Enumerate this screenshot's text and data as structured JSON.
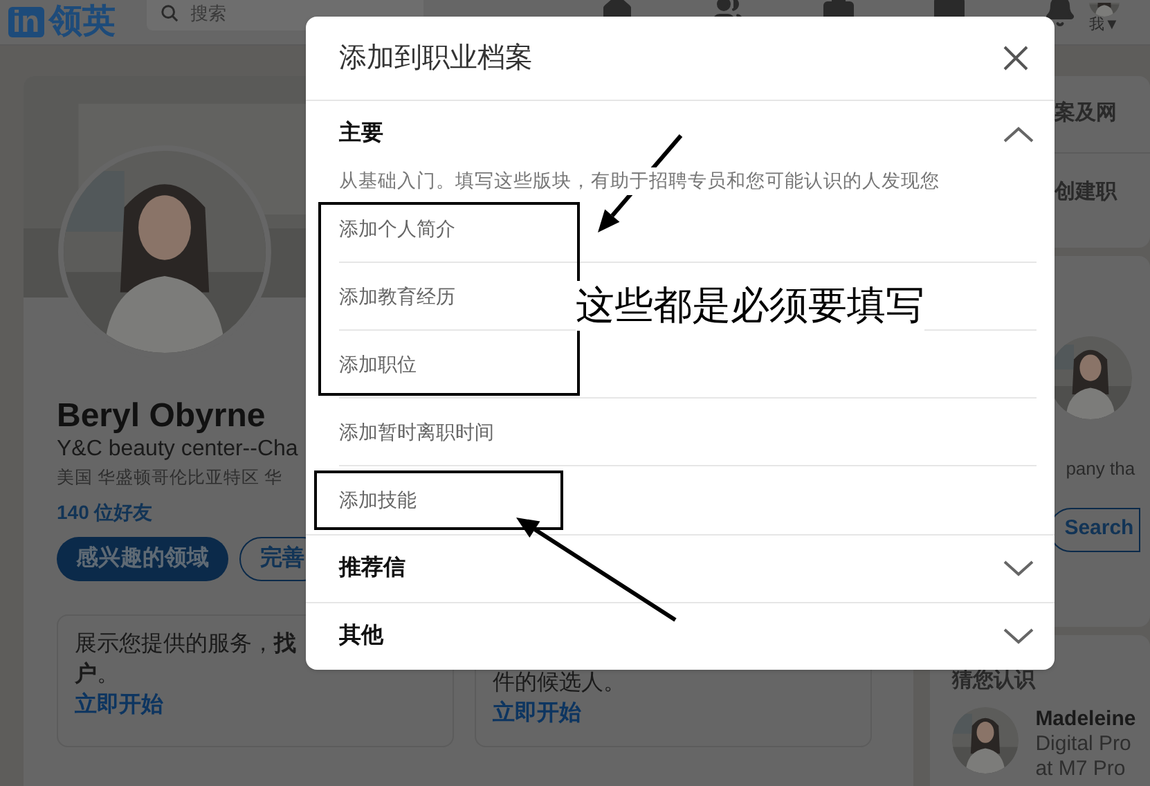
{
  "nav": {
    "logo_badge": "in",
    "logo_text": "领英",
    "search": {
      "placeholder": "搜索"
    },
    "me_label": "我▼"
  },
  "profile": {
    "name": "Beryl Obyrne",
    "headline": "Y&C beauty center--Cha",
    "location": "美国 华盛顿哥伦比亚特区 华",
    "connections": "140 位好友",
    "buttons": [
      {
        "label": "感兴趣的领域",
        "kind": "primary"
      },
      {
        "label": "完善",
        "kind": "outline"
      }
    ],
    "cards": [
      {
        "lines": [
          "展示您提供的服务，**找**",
          "**户**。"
        ],
        "link": "立即开始"
      },
      {
        "lines": [
          "件的候选人。"
        ],
        "link": "立即开始"
      }
    ]
  },
  "sidebar": {
    "links": [
      "案及网",
      "创建职"
    ],
    "promo": {
      "text": "pany tha",
      "button": "Search"
    },
    "suggestions": {
      "title": "猜您认识",
      "people": [
        {
          "name": "Madeleine",
          "lines": [
            "Digital Pro",
            "at M7 Pro"
          ]
        }
      ]
    }
  },
  "modal": {
    "title": "添加到职业档案",
    "sections": [
      {
        "title": "主要",
        "expanded": true,
        "description": "从基础入门。填写这些版块，有助于招聘专员和您可能认识的人发现您",
        "items": [
          "添加个人简介",
          "添加教育经历",
          "添加职位",
          "添加暂时离职时间",
          "添加技能"
        ]
      },
      {
        "title": "推荐信",
        "expanded": false
      },
      {
        "title": "其他",
        "expanded": false
      }
    ]
  },
  "annotation": {
    "note": "这些都是必须要填写"
  }
}
